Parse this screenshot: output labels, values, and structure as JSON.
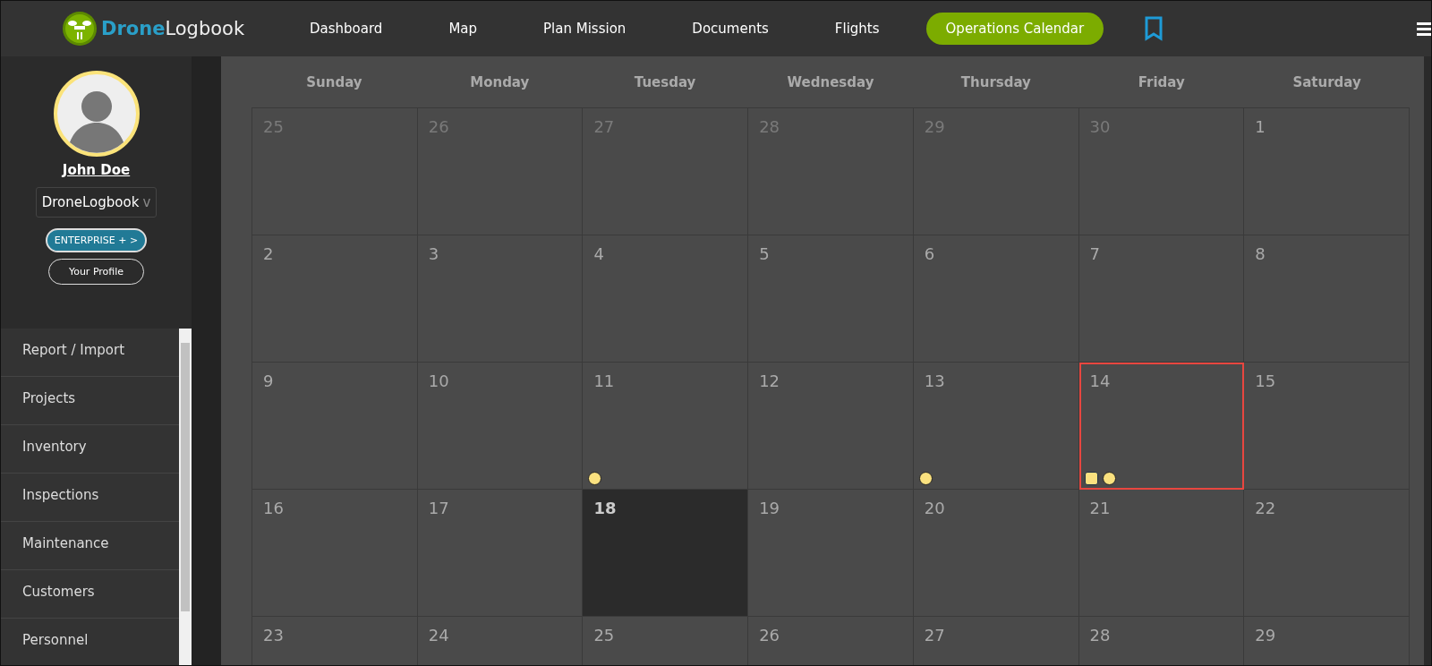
{
  "header": {
    "logo": {
      "brand_first": "Drone",
      "brand_second": "Logbook"
    },
    "nav": [
      {
        "label": "Dashboard",
        "selected": false
      },
      {
        "label": "Map",
        "selected": false
      },
      {
        "label": "Plan Mission",
        "selected": false
      },
      {
        "label": "Documents",
        "selected": false
      },
      {
        "label": "Flights",
        "selected": false
      },
      {
        "label": "Operations Calendar",
        "selected": true
      }
    ]
  },
  "sidebar": {
    "user": {
      "name": "John Doe"
    },
    "organization": {
      "value": "DroneLogbook",
      "caret": "v"
    },
    "plan_button": "ENTERPRISE + >",
    "profile_button": "Your Profile",
    "items": [
      {
        "label": "Report / Import"
      },
      {
        "label": "Projects"
      },
      {
        "label": "Inventory"
      },
      {
        "label": "Inspections"
      },
      {
        "label": "Maintenance"
      },
      {
        "label": "Customers"
      },
      {
        "label": "Personnel"
      }
    ]
  },
  "calendar": {
    "weekdays": [
      "Sunday",
      "Monday",
      "Tuesday",
      "Wednesday",
      "Thursday",
      "Friday",
      "Saturday"
    ],
    "weeks": [
      [
        {
          "day": "25",
          "muted": true
        },
        {
          "day": "26",
          "muted": true
        },
        {
          "day": "27",
          "muted": true
        },
        {
          "day": "28",
          "muted": true
        },
        {
          "day": "29",
          "muted": true
        },
        {
          "day": "30",
          "muted": true
        },
        {
          "day": "1",
          "muted": false
        }
      ],
      [
        {
          "day": "2",
          "muted": false
        },
        {
          "day": "3",
          "muted": false
        },
        {
          "day": "4",
          "muted": false
        },
        {
          "day": "5",
          "muted": false
        },
        {
          "day": "6",
          "muted": false
        },
        {
          "day": "7",
          "muted": false
        },
        {
          "day": "8",
          "muted": false
        }
      ],
      [
        {
          "day": "9",
          "muted": false
        },
        {
          "day": "10",
          "muted": false
        },
        {
          "day": "11",
          "muted": false,
          "events": [
            {
              "kind": "circle",
              "color": "#fae17f"
            }
          ]
        },
        {
          "day": "12",
          "muted": false
        },
        {
          "day": "13",
          "muted": false,
          "events": [
            {
              "kind": "circle",
              "color": "#fae17f"
            }
          ]
        },
        {
          "day": "14",
          "muted": false,
          "selected": true,
          "events": [
            {
              "kind": "square",
              "color": "#fae17f"
            },
            {
              "kind": "circle",
              "color": "#fae17f"
            }
          ]
        },
        {
          "day": "15",
          "muted": false
        }
      ],
      [
        {
          "day": "16",
          "muted": false
        },
        {
          "day": "17",
          "muted": false
        },
        {
          "day": "18",
          "muted": false,
          "today": true
        },
        {
          "day": "19",
          "muted": false
        },
        {
          "day": "20",
          "muted": false
        },
        {
          "day": "21",
          "muted": false
        },
        {
          "day": "22",
          "muted": false
        }
      ],
      [
        {
          "day": "23",
          "muted": false
        },
        {
          "day": "24",
          "muted": false
        },
        {
          "day": "25",
          "muted": false
        },
        {
          "day": "26",
          "muted": false
        },
        {
          "day": "27",
          "muted": false
        },
        {
          "day": "28",
          "muted": false
        },
        {
          "day": "29",
          "muted": false
        }
      ]
    ]
  }
}
